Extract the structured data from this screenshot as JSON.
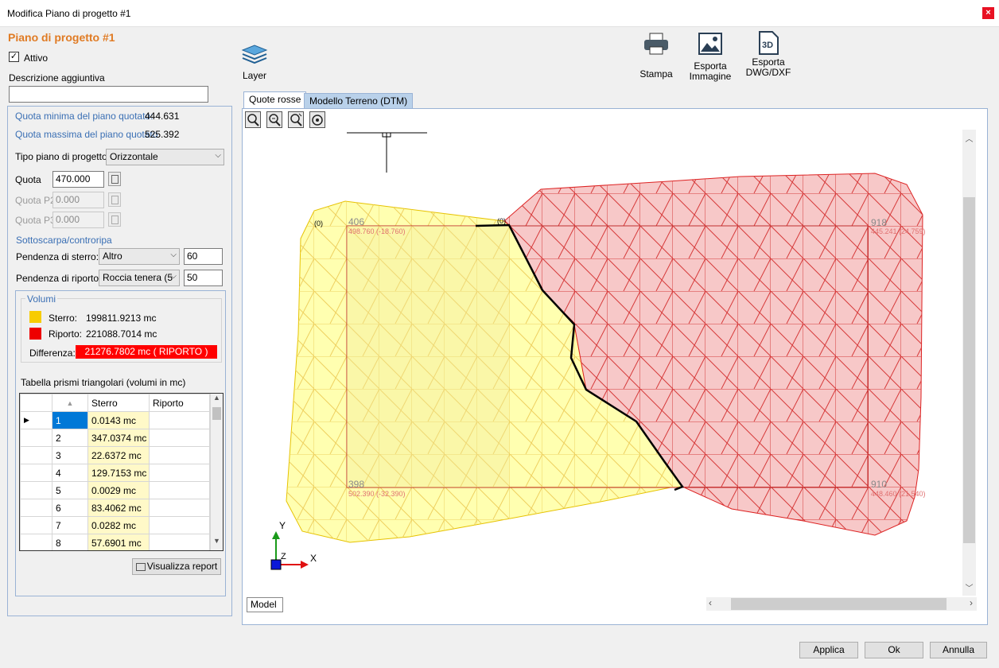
{
  "window": {
    "title": "Modifica Piano di progetto #1",
    "close": "×"
  },
  "plan": {
    "heading": "Piano di progetto #1",
    "active_label": "Attivo",
    "description_label": "Descrizione aggiuntiva",
    "description_value": ""
  },
  "quote": {
    "min_label": "Quota minima del piano quotato:",
    "min_value": "444.631",
    "max_label": "Quota massima del piano quotato",
    "max_value": "525.392"
  },
  "form": {
    "tipo_label": "Tipo piano di progetto:",
    "tipo_value": "Orizzontale",
    "quota_label": "Quota",
    "quota_value": "470.000",
    "quota_p2_label": "Quota P2",
    "quota_p2_value": "0.000",
    "quota_p3_label": "Quota P3",
    "quota_p3_value": "0.000",
    "sottoscarpa_label": "Sottoscarpa/controripa",
    "sterro_label": "Pendenza di sterro:",
    "sterro_select": "Altro",
    "sterro_value": "60",
    "riporto_label": "Pendenza di riporto:",
    "riporto_select": "Roccia tenera (5",
    "riporto_value": "50"
  },
  "volumes": {
    "title": "Volumi",
    "sterro_label": "Sterro:",
    "sterro_value": "199811.9213 mc",
    "riporto_label": "Riporto:",
    "riporto_value": "221088.7014 mc",
    "diff_label": "Differenza:",
    "diff_value": "21276.7802 mc ( RIPORTO )",
    "colors": {
      "sterro": "#f7cc00",
      "riporto": "#ee0000"
    }
  },
  "table": {
    "title": "Tabella prismi triangolari (volumi in mc)",
    "columns": [
      "",
      "Sterro",
      "Riporto"
    ],
    "rows": [
      {
        "id": "1",
        "sterro": "0.0143 mc",
        "riporto": ""
      },
      {
        "id": "2",
        "sterro": "347.0374 mc",
        "riporto": ""
      },
      {
        "id": "3",
        "sterro": "22.6372 mc",
        "riporto": ""
      },
      {
        "id": "4",
        "sterro": "129.7153 mc",
        "riporto": ""
      },
      {
        "id": "5",
        "sterro": "0.0029 mc",
        "riporto": ""
      },
      {
        "id": "6",
        "sterro": "83.4062 mc",
        "riporto": ""
      },
      {
        "id": "7",
        "sterro": "0.0282 mc",
        "riporto": ""
      },
      {
        "id": "8",
        "sterro": "57.6901 mc",
        "riporto": ""
      }
    ],
    "report_button": "Visualizza report"
  },
  "toolbar": {
    "layer": "Layer",
    "stampa": "Stampa",
    "esporta_immagine_1": "Esporta",
    "esporta_immagine_2": "Immagine",
    "esporta_dwg_1": "Esporta",
    "esporta_dwg_2": "DWG/DXF",
    "dwg_icon_text": "3D"
  },
  "tabs": {
    "quote_rosse": "Quote rosse",
    "dtm": "Modello Terreno (DTM)"
  },
  "drawing": {
    "model_tab": "Model",
    "marker_zero": "(0)",
    "corners": [
      {
        "id": "406",
        "coords": "498.760 (-18.760)"
      },
      {
        "id": "918",
        "coords": "445.241 (24.759)"
      },
      {
        "id": "398",
        "coords": "502.390 (-32.390)"
      },
      {
        "id": "910",
        "coords": "448.460 (21.540)"
      }
    ],
    "axis_x": "X",
    "axis_y": "Y",
    "axis_z": "Z"
  },
  "footer": {
    "applica": "Applica",
    "ok": "Ok",
    "annulla": "Annulla"
  }
}
